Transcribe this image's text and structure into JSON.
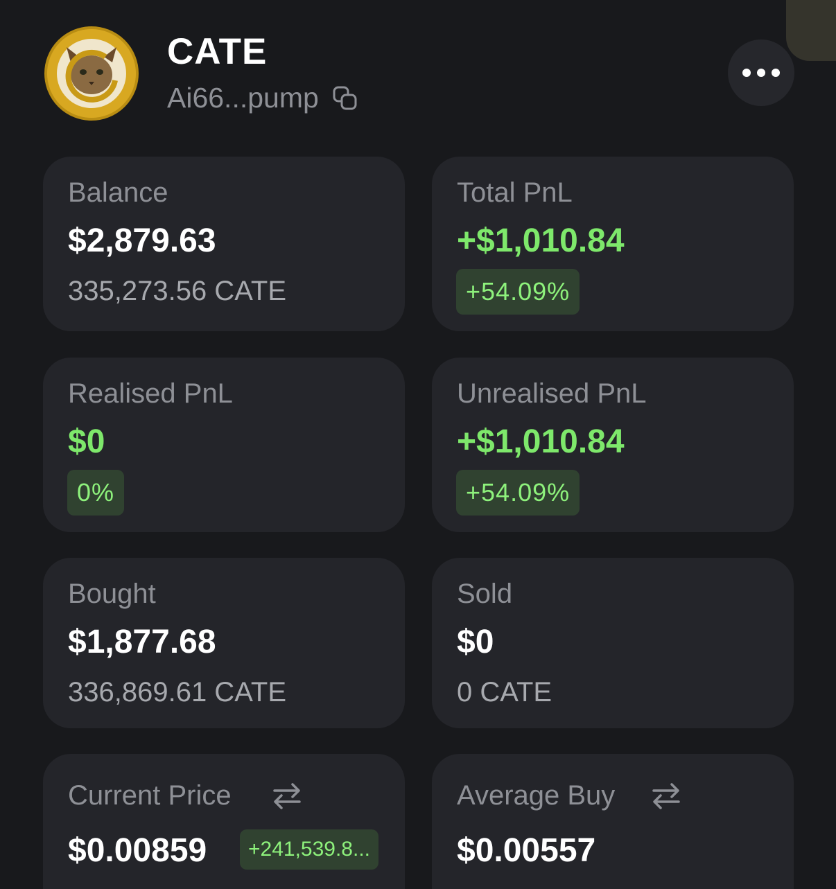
{
  "colors": {
    "background": "#18191c",
    "card": "#24252a",
    "positive": "#7ee86b",
    "positive_badge_bg": "#304230",
    "muted_text": "#8e9096"
  },
  "header": {
    "token_name": "CATE",
    "address": "Ai66...pump",
    "avatar_icon": "cat-coin-logo",
    "copy_icon": "copy-icon",
    "more_icon": "more-horizontal-icon"
  },
  "cards": {
    "balance": {
      "label": "Balance",
      "value": "$2,879.63",
      "sub": "335,273.56 CATE"
    },
    "total_pnl": {
      "label": "Total PnL",
      "value": "+$1,010.84",
      "badge": "+54.09%"
    },
    "realised_pnl": {
      "label": "Realised PnL",
      "value": "$0",
      "badge": "0%"
    },
    "unrealised_pnl": {
      "label": "Unrealised PnL",
      "value": "+$1,010.84",
      "badge": "+54.09%"
    },
    "bought": {
      "label": "Bought",
      "value": "$1,877.68",
      "sub": "336,869.61 CATE"
    },
    "sold": {
      "label": "Sold",
      "value": "$0",
      "sub": "0 CATE"
    },
    "current_price": {
      "label": "Current Price",
      "value": "$0.00859",
      "badge": "+241,539.8...",
      "icon": "swap-icon"
    },
    "average_buy": {
      "label": "Average Buy",
      "value": "$0.00557",
      "icon": "swap-icon"
    }
  }
}
